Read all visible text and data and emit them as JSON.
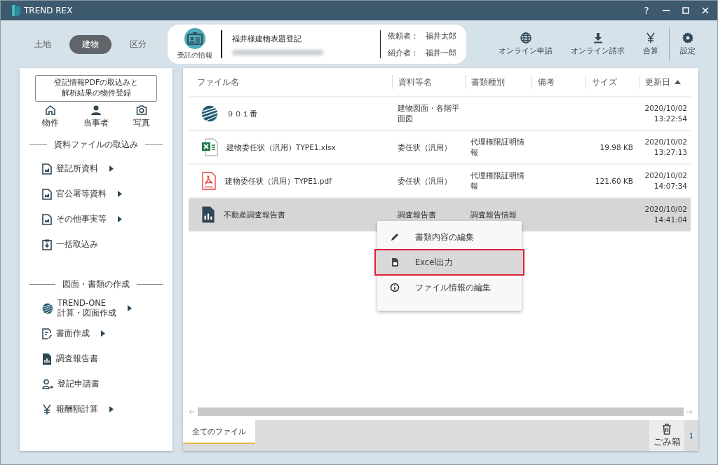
{
  "window": {
    "title": "TREND REX",
    "controls": [
      {
        "kind": "help",
        "label": "?"
      },
      {
        "kind": "minimize"
      },
      {
        "kind": "maximize"
      },
      {
        "kind": "close"
      }
    ]
  },
  "modes": [
    {
      "label": "土地",
      "selected": false
    },
    {
      "label": "建物",
      "selected": true
    },
    {
      "label": "区分",
      "selected": false
    }
  ],
  "case_card": {
    "button_label": "受託の情報",
    "title": "福井様建物表題登記",
    "requester_label": "依頼者：",
    "requester": "福井太郎",
    "introducer_label": "紹介者：",
    "introducer": "福井一郎"
  },
  "toolbar": [
    {
      "kind": "globe",
      "label": "オンライン申請"
    },
    {
      "kind": "download",
      "label": "オンライン請求"
    },
    {
      "kind": "yen",
      "label": "合算"
    },
    {
      "kind": "gear",
      "label": "設定"
    }
  ],
  "sidebar": {
    "import_button": [
      "登記情報PDFの取込みと",
      "解析結果の物件登録"
    ],
    "quick_links": [
      {
        "kind": "home",
        "label": "物件"
      },
      {
        "kind": "person",
        "label": "当事者"
      },
      {
        "kind": "camera",
        "label": "写真"
      }
    ],
    "sections": [
      {
        "title": "資料ファイルの取込み",
        "items": [
          {
            "kind": "doc",
            "label": "登記所資料",
            "submenu": true
          },
          {
            "kind": "doc",
            "label": "官公署等資料",
            "submenu": true
          },
          {
            "kind": "doc",
            "label": "その他事実等",
            "submenu": true
          },
          {
            "kind": "clipboard",
            "label": "一括取込み",
            "submenu": false
          }
        ]
      },
      {
        "title": "図面・書類の作成",
        "items": [
          {
            "kind": "trendone",
            "label": "TREND-ONE\n計算・図面作成",
            "submenu": true
          },
          {
            "kind": "pen-doc",
            "label": "書面作成",
            "submenu": true
          },
          {
            "kind": "report",
            "label": "調査報告書",
            "submenu": false
          },
          {
            "kind": "person-arrow",
            "label": "登記申請書",
            "submenu": false
          },
          {
            "kind": "yen",
            "label": "報酬額計算",
            "submenu": true
          }
        ]
      }
    ]
  },
  "file_table": {
    "columns": [
      {
        "label": "ファイル名",
        "sorted": false
      },
      {
        "label": "資料等名",
        "sorted": false
      },
      {
        "label": "書類種別",
        "sorted": false
      },
      {
        "label": "備考",
        "sorted": false
      },
      {
        "label": "サイズ",
        "sorted": false
      },
      {
        "label": "更新日",
        "sorted": true
      }
    ],
    "rows": [
      {
        "kind": "trendone",
        "name": "９０１番",
        "material": "建物図面・各階平面図",
        "updated": "2020/10/02",
        "time": "13:22:54",
        "selected": false
      },
      {
        "kind": "excel",
        "name": "建物委任状（汎用）TYPE1.xlsx",
        "material": "委任状（汎用）",
        "doc_type": "代理権限証明情報",
        "size": "19.98 KB",
        "updated": "2020/10/02",
        "time": "13:27:13",
        "selected": false
      },
      {
        "kind": "pdf",
        "name": "建物委任状（汎用）TYPE1.pdf",
        "material": "委任状（汎用）",
        "doc_type": "代理権限証明情報",
        "size": "121.60 KB",
        "updated": "2020/10/02",
        "time": "14:07:34",
        "selected": false
      },
      {
        "kind": "report",
        "name": "不動産調査報告書",
        "material": "調査報告書",
        "doc_type": "調査報告情報",
        "updated": "2020/10/02",
        "time": "14:41:04",
        "selected": true
      }
    ]
  },
  "context_menu": [
    {
      "kind": "edit",
      "label": "書類内容の編集",
      "selected": false
    },
    {
      "kind": "excel",
      "label": "Excel出力",
      "selected": true
    },
    {
      "kind": "info",
      "label": "ファイル情報の編集",
      "selected": false
    }
  ],
  "bottom_tabs": [
    {
      "label": "全てのファイル",
      "selected": true
    }
  ],
  "trash": {
    "label": "ごみ箱",
    "count": "1"
  }
}
